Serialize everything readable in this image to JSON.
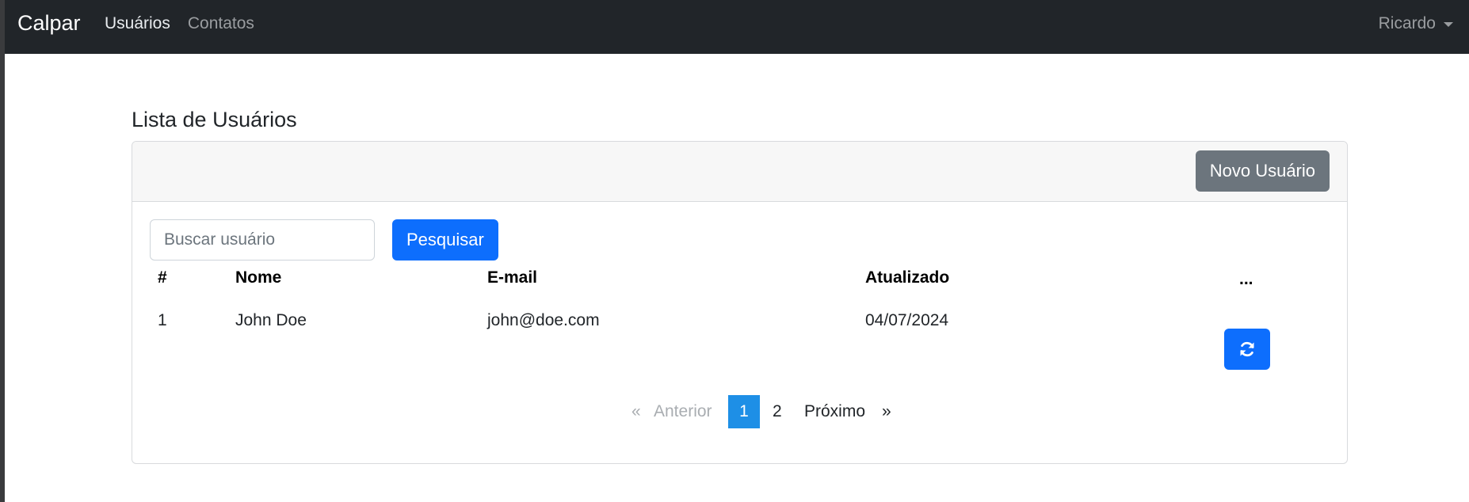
{
  "navbar": {
    "brand": "Calpar",
    "links": [
      {
        "label": "Usuários",
        "active": true
      },
      {
        "label": "Contatos",
        "active": false
      }
    ],
    "user": "Ricardo"
  },
  "page": {
    "title": "Lista de Usuários"
  },
  "card": {
    "new_button": "Novo Usuário",
    "search": {
      "placeholder": "Buscar usuário",
      "value": ""
    },
    "search_button": "Pesquisar"
  },
  "table": {
    "headers": [
      "#",
      "Nome",
      "E-mail",
      "Atualizado",
      "..."
    ],
    "rows": [
      {
        "id": "1",
        "name": "John Doe",
        "email": "john@doe.com",
        "updated": "04/07/2024",
        "action_icon": "refresh-icon"
      }
    ]
  },
  "pagination": {
    "first": "«",
    "previous": "Anterior",
    "pages": [
      "1",
      "2"
    ],
    "current": "1",
    "next": "Próximo",
    "last": "»"
  },
  "colors": {
    "navbar": "#212529",
    "primary": "#0d6efd",
    "secondary": "#6c757d",
    "active_page": "#1e8fe6"
  }
}
